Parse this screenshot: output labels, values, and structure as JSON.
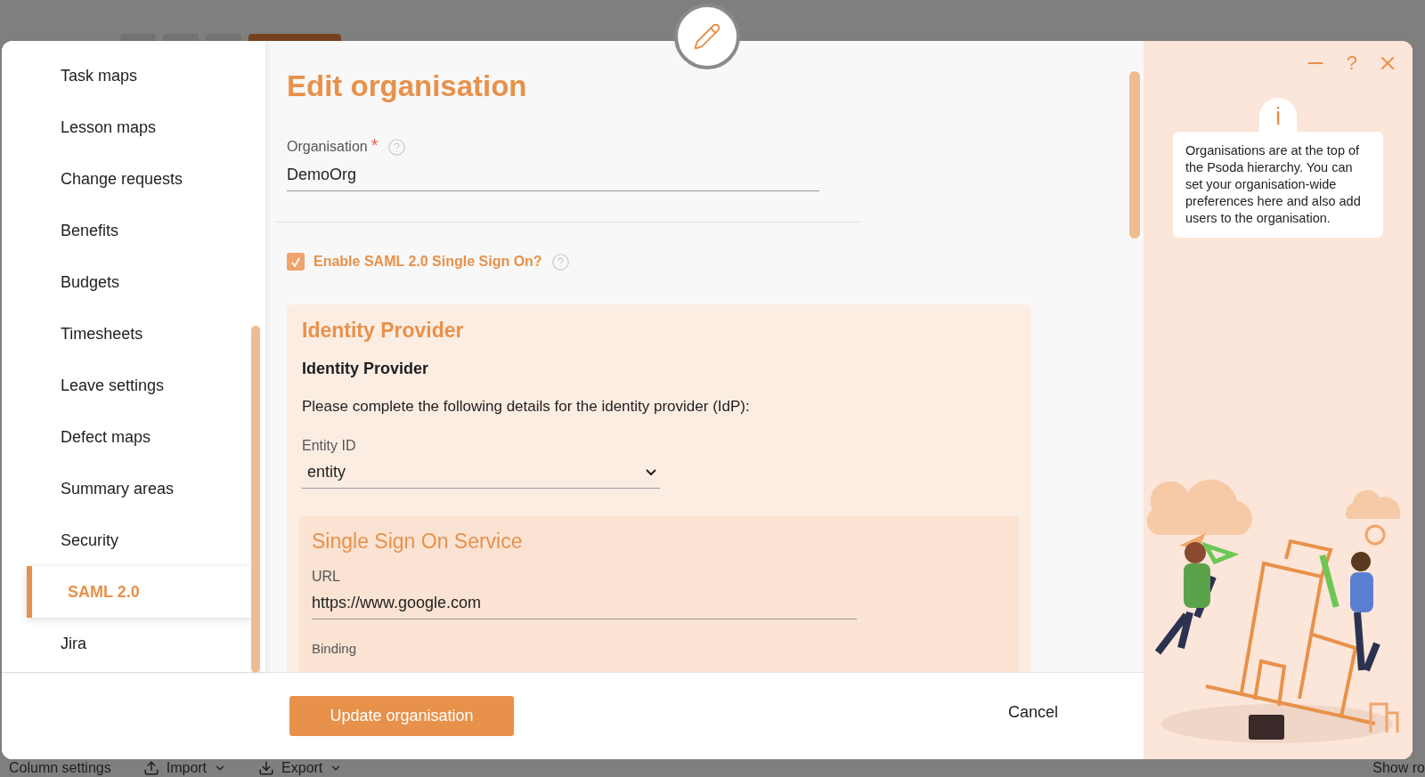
{
  "background": {
    "toolbar_items": [
      {
        "label": "Column settings",
        "kind": "plain"
      },
      {
        "label": "Import",
        "kind": "menu"
      },
      {
        "label": "Export",
        "kind": "menu"
      },
      {
        "label": "Show ro",
        "kind": "plain"
      }
    ]
  },
  "sidebar": {
    "items": [
      {
        "label": "Task maps",
        "selected": false
      },
      {
        "label": "Lesson maps",
        "selected": false
      },
      {
        "label": "Change requests",
        "selected": false
      },
      {
        "label": "Benefits",
        "selected": false
      },
      {
        "label": "Budgets",
        "selected": false
      },
      {
        "label": "Timesheets",
        "selected": false
      },
      {
        "label": "Leave settings",
        "selected": false
      },
      {
        "label": "Defect maps",
        "selected": false
      },
      {
        "label": "Summary areas",
        "selected": false
      },
      {
        "label": "Security",
        "selected": false
      },
      {
        "label": "SAML 2.0",
        "selected": true
      },
      {
        "label": "Jira",
        "selected": false
      }
    ]
  },
  "form": {
    "title": "Edit organisation",
    "organisation": {
      "label": "Organisation",
      "required_mark": "*",
      "value": "DemoOrg"
    },
    "saml_toggle": {
      "label": "Enable SAML 2.0 Single Sign On?",
      "checked": true
    },
    "identity_provider": {
      "title": "Identity Provider",
      "subtitle": "Identity Provider",
      "description": "Please complete the following details for the identity provider (IdP):",
      "entity_id": {
        "label": "Entity ID",
        "value": "entity"
      },
      "sso_service": {
        "title": "Single Sign On Service",
        "url": {
          "label": "URL",
          "value": "https://www.google.com"
        },
        "binding": {
          "label": "Binding"
        }
      }
    }
  },
  "window_controls": {
    "help": "?"
  },
  "footer": {
    "primary_button": "Update organisation",
    "cancel": "Cancel"
  },
  "info_panel": {
    "badge": "i",
    "text": "Organisations are at the top of the Psoda hierarchy. You can set your organisation-wide preferences here and also add users to the organisation."
  }
}
